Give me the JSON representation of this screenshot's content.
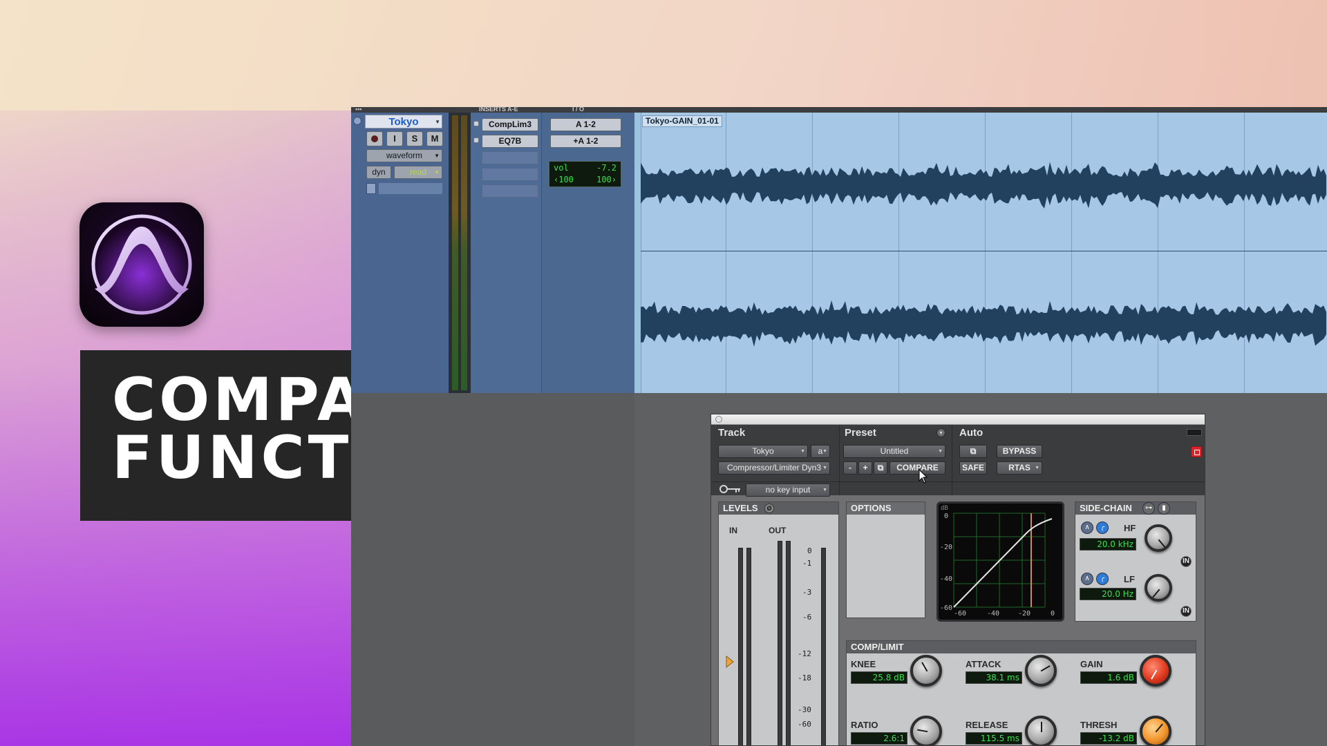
{
  "thumbnail": {
    "title_line1": "COMPARE",
    "title_line2": "FUNCTION"
  },
  "protools": {
    "column_headers": [
      "INSERTS A-E",
      "I / O"
    ],
    "track": {
      "name": "Tokyo",
      "buttons": [
        "I",
        "S",
        "M"
      ],
      "view": "waveform",
      "dyn": "dyn",
      "automation": "read"
    },
    "inserts": [
      "CompLim3",
      "EQ7B"
    ],
    "io": {
      "input": "A 1-2",
      "output": "+A 1-2",
      "vol_label": "vol",
      "vol_value": "-7.2",
      "pan_left": "‹100",
      "pan_right": "100›"
    },
    "region_name": "Tokyo-GAIN_01-01"
  },
  "plugin": {
    "headers": {
      "track": "Track",
      "preset": "Preset",
      "auto": "Auto"
    },
    "track_select": "Tokyo",
    "track_chan": "a",
    "plugin_name": "Compressor/Limiter Dyn3",
    "preset_name": "Untitled",
    "preset_minus": "-",
    "preset_plus": "+",
    "compare": "COMPARE",
    "bypass": "BYPASS",
    "safe": "SAFE",
    "rtas": "RTAS",
    "key_input": "no key input",
    "levels": {
      "title": "LEVELS",
      "in": "IN",
      "out": "OUT",
      "ticks": [
        "0",
        "-1",
        "-3",
        "-6",
        "-12",
        "-18",
        "-30",
        "-60"
      ]
    },
    "options_title": "OPTIONS",
    "graph": {
      "db_label": "dB",
      "y_ticks": [
        "0",
        "-20",
        "-40",
        "-60"
      ],
      "x_ticks": [
        "-60",
        "-40",
        "-20",
        "0"
      ]
    },
    "sidechain": {
      "title": "SIDE-CHAIN",
      "hf_label": "HF",
      "hf_value": "20.0 kHz",
      "lf_label": "LF",
      "lf_value": "20.0 Hz",
      "in_label": "IN"
    },
    "complimit": {
      "title": "COMP/LIMIT",
      "knee_label": "KNEE",
      "knee_value": "25.8 dB",
      "attack_label": "ATTACK",
      "attack_value": "38.1 ms",
      "gain_label": "GAIN",
      "gain_value": "1.6 dB",
      "ratio_label": "RATIO",
      "ratio_value": "2.6:1",
      "release_label": "RELEASE",
      "release_value": "115.5 ms",
      "thresh_label": "THRESH",
      "thresh_value": "-13.2 dB"
    }
  },
  "colors": {
    "title_box": "#262626",
    "region": "#a6c8e6",
    "waveform": "#22415f",
    "meter_green": "#3ce24e",
    "gain_knob": "#e03a1f",
    "thresh_knob": "#f2952e"
  }
}
